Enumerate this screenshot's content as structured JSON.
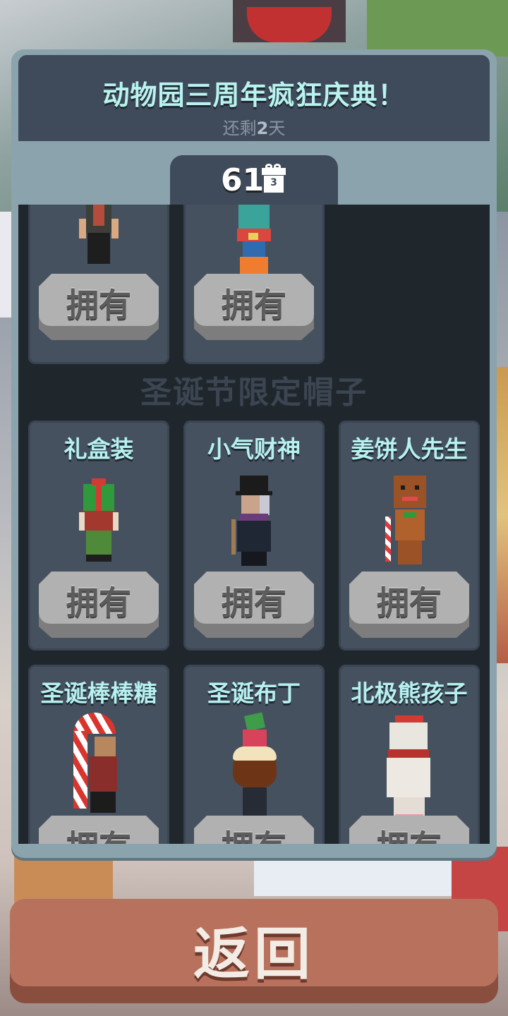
{
  "event": {
    "title": "动物园三周年疯狂庆典！",
    "remaining_prefix": "还剩",
    "remaining_days": "2",
    "remaining_suffix": "天"
  },
  "tab": {
    "count": "61",
    "gift_number": "3",
    "icon": "gift-icon"
  },
  "own_label": "拥有",
  "top_cards": [
    {
      "name": ""
    },
    {
      "name": ""
    }
  ],
  "section_title": "圣诞节限定帽子",
  "christmas_cards": [
    {
      "name": "礼盒装"
    },
    {
      "name": "小气财神"
    },
    {
      "name": "姜饼人先生"
    },
    {
      "name": "圣诞棒棒糖"
    },
    {
      "name": "圣诞布丁"
    },
    {
      "name": "北极熊孩子"
    }
  ],
  "back_button": {
    "label": "返回"
  },
  "colors": {
    "accent_text": "#b9f3ef",
    "panel": "#3f4a5a",
    "back_button": "#b8715c"
  }
}
